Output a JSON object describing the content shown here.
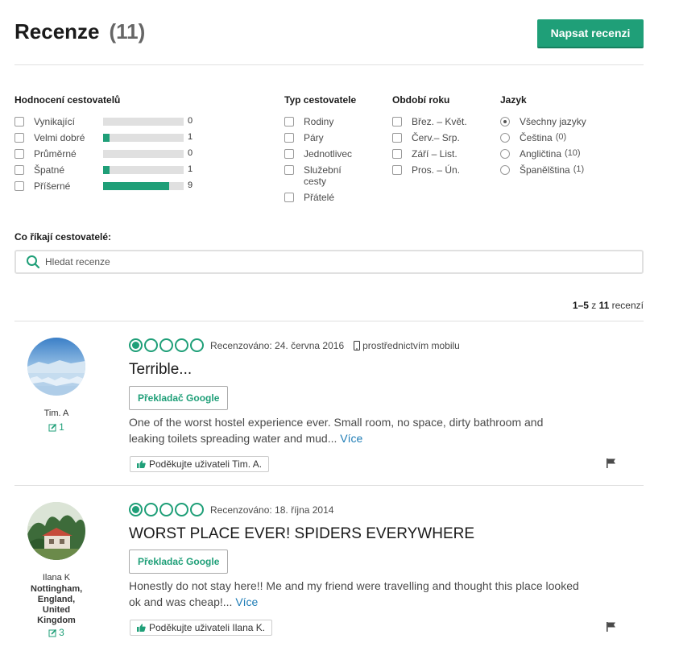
{
  "header": {
    "title": "Recenze",
    "count": "(11)",
    "write_button": "Napsat recenzi"
  },
  "filters": {
    "rating": {
      "title": "Hodnocení cestovatelů",
      "items": [
        {
          "label": "Vynikající",
          "count": "0",
          "fraction": 0
        },
        {
          "label": "Velmi dobré",
          "count": "1",
          "fraction": 0.08
        },
        {
          "label": "Průměrné",
          "count": "0",
          "fraction": 0
        },
        {
          "label": "Špatné",
          "count": "1",
          "fraction": 0.08
        },
        {
          "label": "Příšerné",
          "count": "9",
          "fraction": 0.82
        }
      ]
    },
    "traveler_type": {
      "title": "Typ cestovatele",
      "items": [
        "Rodiny",
        "Páry",
        "Jednotlivec",
        "Služební cesty",
        "Přátelé"
      ]
    },
    "season": {
      "title": "Období roku",
      "items": [
        "Břez. – Květ.",
        "Červ.– Srp.",
        "Září – List.",
        "Pros. – Ún."
      ]
    },
    "language": {
      "title": "Jazyk",
      "items": [
        {
          "label": "Všechny jazyky",
          "count": "",
          "selected": true
        },
        {
          "label": "Čeština",
          "count": "(0)",
          "selected": false
        },
        {
          "label": "Angličtina",
          "count": "(10)",
          "selected": false
        },
        {
          "label": "Španělština",
          "count": "(1)",
          "selected": false
        }
      ]
    }
  },
  "search": {
    "title": "Co říkají cestovatelé:",
    "placeholder": "Hledat recenze"
  },
  "pager": {
    "range": "1–5",
    "of": "z",
    "total": "11",
    "suffix": "recenzí"
  },
  "reviews": [
    {
      "user": "Tim. A",
      "location": "",
      "review_count": "1",
      "rating": 1,
      "date": "Recenzováno: 24. června 2016",
      "mobile": "prostřednictvím mobilu",
      "title": "Terrible...",
      "translate": "Překladač Google",
      "text": "One of the worst hostel experience ever. Small room, no space, dirty bathroom and leaking toilets spreading water and mud...",
      "more": "Více",
      "thanks": "Poděkujte uživateli Tim. A."
    },
    {
      "user": "Ilana K",
      "location": "Nottingham, England, United Kingdom",
      "review_count": "3",
      "rating": 1,
      "date": "Recenzováno: 18. října 2014",
      "mobile": "",
      "title": "WORST PLACE EVER! SPIDERS EVERYWHERE",
      "translate": "Překladač Google",
      "text": "Honestly do not stay here!! Me and my friend were travelling and thought this place looked ok and was cheap!...",
      "more": "Více",
      "thanks": "Poděkujte uživateli Ilana K."
    }
  ],
  "colors": {
    "accent": "#1f9f78",
    "link": "#1f7db6"
  }
}
